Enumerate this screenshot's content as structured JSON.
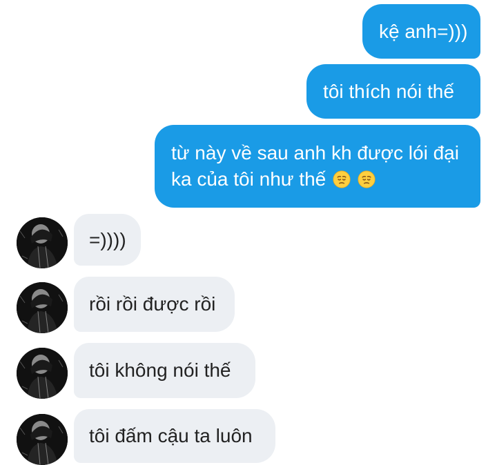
{
  "messages": {
    "outgoing": [
      "kệ anh=)))",
      "tôi thích nói thế",
      "từ này về sau anh kh được lói đại",
      "ka của tôi như thế"
    ],
    "incoming": [
      "=))))",
      "rồi rồi được rồi",
      "tôi không nói thế",
      "tôi đấm cậu ta luôn"
    ]
  },
  "colors": {
    "outgoing_bubble": "#1a9be6",
    "incoming_bubble": "#eceff3",
    "background": "#ffffff"
  },
  "icons": {
    "emoji": "pensive-face-icon",
    "avatar": "avatar"
  }
}
